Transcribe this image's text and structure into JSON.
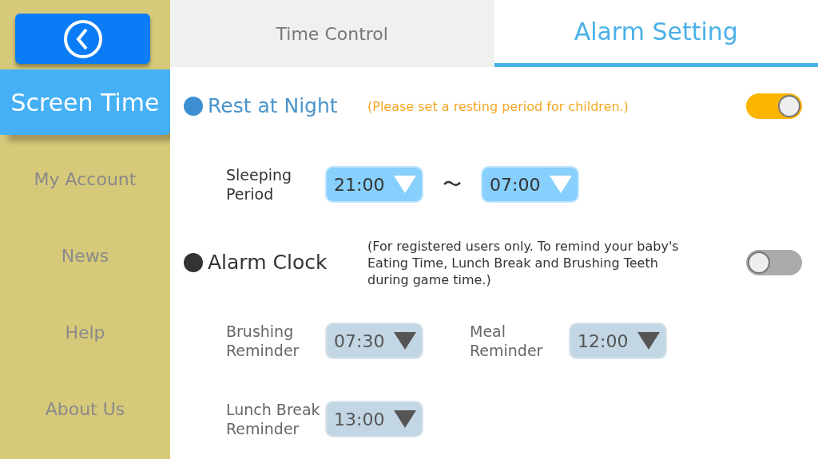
{
  "sidebar": {
    "items": [
      {
        "label": "Screen Time",
        "selected": true
      },
      {
        "label": "My Account",
        "selected": false
      },
      {
        "label": "News",
        "selected": false
      },
      {
        "label": "Help",
        "selected": false
      },
      {
        "label": "About Us",
        "selected": false
      }
    ]
  },
  "tabs": [
    {
      "label": "Time Control",
      "selected": false
    },
    {
      "label": "Alarm Setting",
      "selected": true
    }
  ],
  "sections": [
    {
      "title": "Rest at Night",
      "note": "(Please set a resting period for children.)",
      "on": true,
      "rows": [
        {
          "label": "Sleeping Period",
          "times": [
            "21:00",
            "07:00"
          ],
          "separator": "〜"
        }
      ]
    },
    {
      "title": "Alarm Clock",
      "note": "(For registered users only. To remind your baby's Eating Time, Lunch Break and Brushing Teeth during game time.)",
      "on": false,
      "rows": [
        {
          "label": "Brushing Reminder",
          "times": [
            "07:30"
          ]
        },
        {
          "label": "Meal Reminder",
          "times": [
            "12:00"
          ]
        },
        {
          "label": "Lunch Break Reminder",
          "times": [
            "13:00"
          ]
        }
      ]
    }
  ]
}
